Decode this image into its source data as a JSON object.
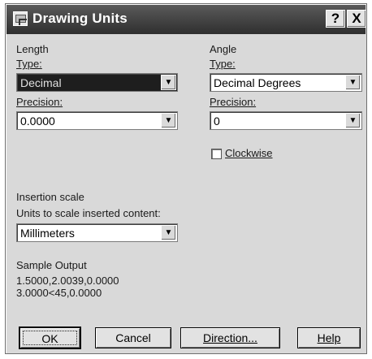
{
  "window": {
    "title": "Drawing Units",
    "help_glyph": "?",
    "close_glyph": "X"
  },
  "length": {
    "group_label": "Length",
    "type_label": "Type:",
    "type_value": "Decimal",
    "precision_label": "Precision:",
    "precision_value": "0.0000"
  },
  "angle": {
    "group_label": "Angle",
    "type_label": "Type:",
    "type_value": "Decimal Degrees",
    "precision_label": "Precision:",
    "precision_value": "0",
    "clockwise_label": "Clockwise",
    "clockwise_checked": false
  },
  "insertion": {
    "group_label": "Insertion scale",
    "units_label": "Units to scale inserted content:",
    "units_value": "Millimeters"
  },
  "sample": {
    "group_label": "Sample Output",
    "line1": "1.5000,2.0039,0.0000",
    "line2": "3.0000<45,0.0000"
  },
  "buttons": {
    "ok": "OK",
    "cancel": "Cancel",
    "direction": "Direction...",
    "help": "Help"
  },
  "icons": {
    "dropdown": "chevron-down-icon",
    "app": "drawing-units-icon"
  }
}
